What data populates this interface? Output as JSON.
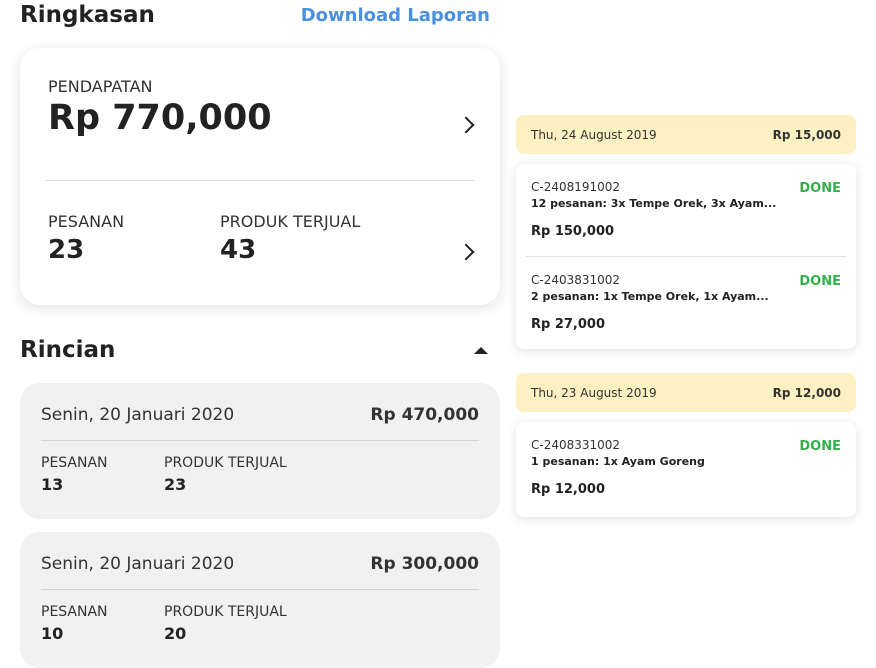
{
  "summary": {
    "title": "Ringkasan",
    "download_label": "Download Laporan",
    "revenue_label": "PENDAPATAN",
    "revenue_value": "Rp 770,000",
    "orders_label": "PESANAN",
    "orders_value": "23",
    "products_label": "PRODUK TERJUAL",
    "products_value": "43"
  },
  "rincian": {
    "title": "Rincian",
    "items": [
      {
        "date": "Senin, 20 Januari 2020",
        "amount": "Rp 470,000",
        "orders_label": "PESANAN",
        "orders": "13",
        "products_label": "PRODUK TERJUAL",
        "products": "23"
      },
      {
        "date": "Senin, 20 Januari 2020",
        "amount": "Rp 300,000",
        "orders_label": "PESANAN",
        "orders": "10",
        "products_label": "PRODUK TERJUAL",
        "products": "20"
      }
    ]
  },
  "days": [
    {
      "date": "Thu, 24 August 2019",
      "total": "Rp 15,000",
      "orders": [
        {
          "id": "C-2408191002",
          "desc": "12 pesanan: 3x Tempe Orek, 3x Ayam...",
          "price": "Rp 150,000",
          "status": "DONE"
        },
        {
          "id": "C-2403831002",
          "desc": "2 pesanan: 1x Tempe Orek, 1x Ayam...",
          "price": "Rp 27,000",
          "status": "DONE"
        }
      ]
    },
    {
      "date": "Thu, 23 August 2019",
      "total": "Rp 12,000",
      "orders": [
        {
          "id": "C-2408331002",
          "desc": "1 pesanan: 1x Ayam Goreng",
          "price": "Rp 12,000",
          "status": "DONE"
        }
      ]
    }
  ],
  "colors": {
    "accent": "#4a8fe0",
    "done": "#33b24a",
    "banner": "#fdf0c2",
    "card_gray": "#f1f1f1"
  },
  "icons": {
    "chevron": "chevron-right-icon",
    "collapse": "caret-up-icon"
  }
}
